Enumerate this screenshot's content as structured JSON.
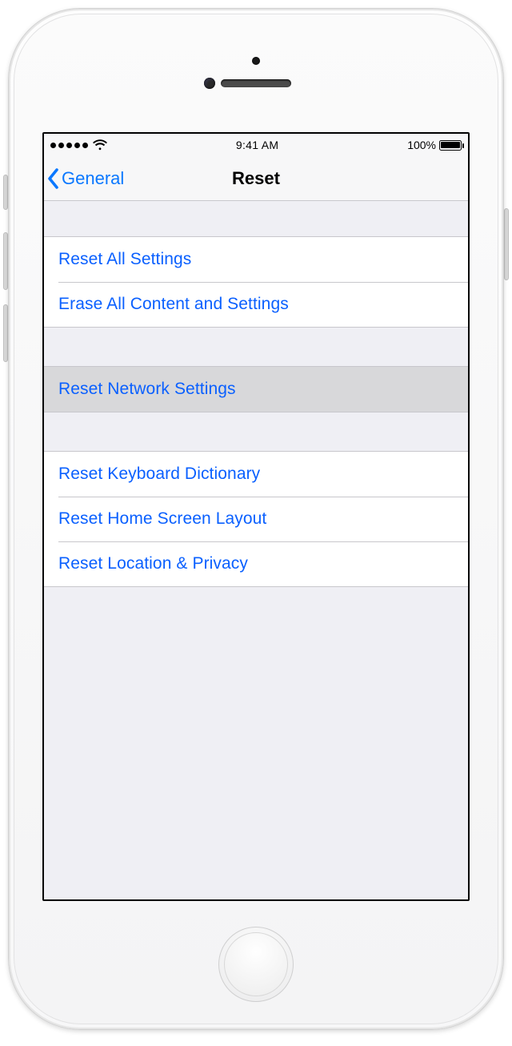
{
  "status": {
    "time": "9:41 AM",
    "battery_pct": "100%"
  },
  "nav": {
    "back_label": "General",
    "title": "Reset"
  },
  "groups": {
    "g1": {
      "items": [
        {
          "label": "Reset All Settings"
        },
        {
          "label": "Erase All Content and Settings"
        }
      ]
    },
    "g2": {
      "items": [
        {
          "label": "Reset Network Settings"
        }
      ]
    },
    "g3": {
      "items": [
        {
          "label": "Reset Keyboard Dictionary"
        },
        {
          "label": "Reset Home Screen Layout"
        },
        {
          "label": "Reset Location & Privacy"
        }
      ]
    }
  }
}
